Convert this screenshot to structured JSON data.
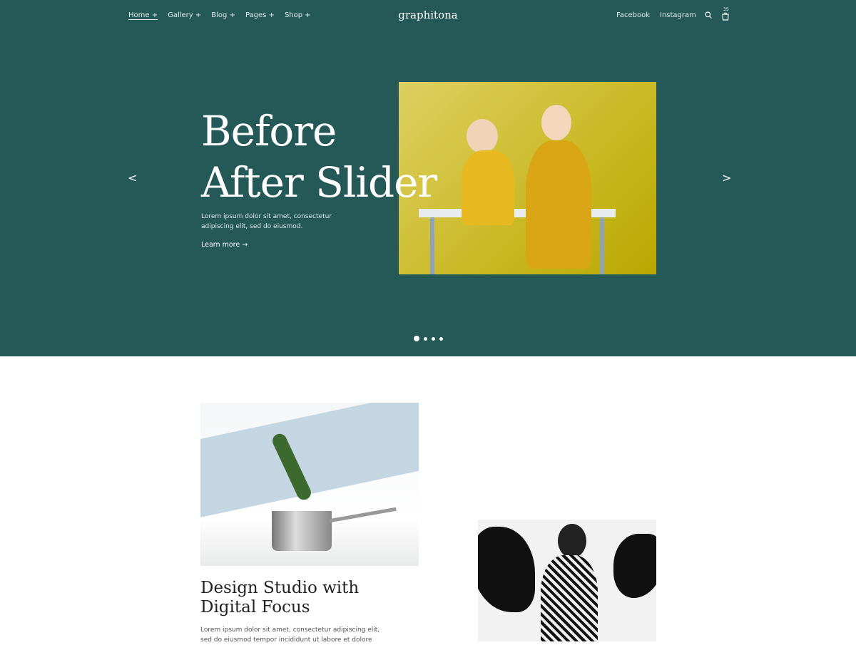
{
  "nav": {
    "left": [
      "Home +",
      "Gallery +",
      "Blog +",
      "Pages +",
      "Shop +"
    ],
    "right": [
      "Facebook",
      "Instagram"
    ],
    "cart_count": "35"
  },
  "logo": "graphitona",
  "hero": {
    "title_line1": "Before",
    "title_line2": "After Slider",
    "description": "Lorem ipsum dolor sit amet, consectetur adipiscing elit, sed do eiusmod.",
    "cta": "Learn more →",
    "prev": "<",
    "next": ">",
    "active_slide": 1,
    "slide_count": 4
  },
  "feature": {
    "title": "Design Studio with Digital Focus",
    "text": "Lorem ipsum dolor sit amet, consectetur adipiscing elit, sed do eiusmod tempor incididunt ut labore et dolore"
  },
  "colors": {
    "hero_bg": "#255957"
  }
}
